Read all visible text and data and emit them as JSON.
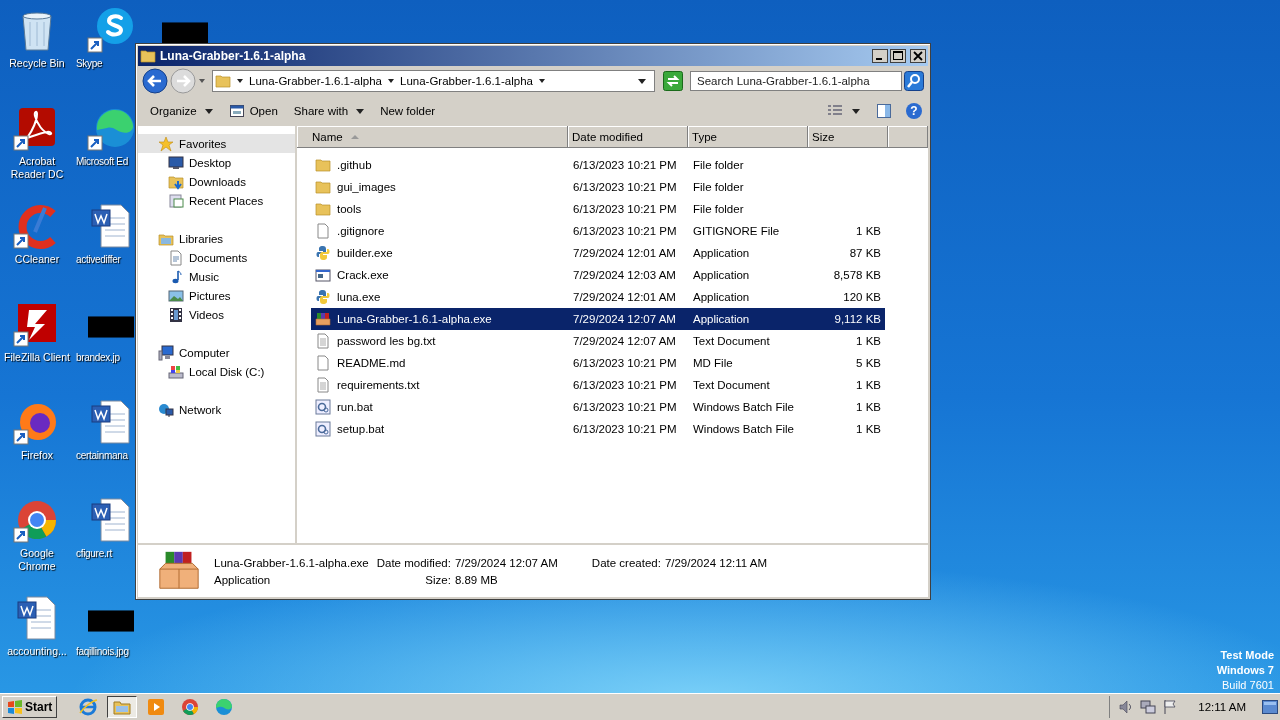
{
  "desktop": {
    "icon_columns": [
      {
        "icons": [
          {
            "label": "Recycle Bin",
            "kind": "recycle",
            "shortcut": false
          },
          {
            "label": "Acrobat Reader DC",
            "kind": "acrobat",
            "shortcut": true
          },
          {
            "label": "CCleaner",
            "kind": "ccleaner",
            "shortcut": true
          },
          {
            "label": "FileZilla Client",
            "kind": "filezilla",
            "shortcut": true
          },
          {
            "label": "Firefox",
            "kind": "firefox",
            "shortcut": true
          },
          {
            "label": "Google Chrome",
            "kind": "chrome",
            "shortcut": true
          },
          {
            "label": "accounting...",
            "kind": "word",
            "shortcut": false
          }
        ]
      },
      {
        "icons": [
          {
            "label": "Skype",
            "kind": "skype",
            "shortcut": true
          },
          {
            "label": "Microsoft Ed",
            "kind": "edge",
            "shortcut": true
          },
          {
            "label": "activediffer",
            "kind": "word",
            "shortcut": false
          },
          {
            "label": "brandex.jp",
            "kind": "redacted",
            "shortcut": false
          },
          {
            "label": "certainmana",
            "kind": "word",
            "shortcut": false
          },
          {
            "label": "cfigure.rt",
            "kind": "word",
            "shortcut": false
          },
          {
            "label": "faqillinois.jpg",
            "kind": "redacted",
            "shortcut": false
          }
        ]
      },
      {
        "icons": [
          {
            "kind": "redacted",
            "shortcut": false
          }
        ]
      }
    ]
  },
  "window": {
    "title": "Luna-Grabber-1.6.1-alpha",
    "breadcrumb": [
      "Luna-Grabber-1.6.1-alpha",
      "Luna-Grabber-1.6.1-alpha"
    ],
    "search": {
      "placeholder": "Search Luna-Grabber-1.6.1-alpha"
    },
    "toolbar": [
      {
        "label": "Organize",
        "kind": "plain",
        "dropdown": true
      },
      {
        "label": "Open",
        "kind": "open",
        "dropdown": false
      },
      {
        "label": "Share with",
        "kind": "plain",
        "dropdown": true
      },
      {
        "label": "New folder",
        "kind": "plain",
        "dropdown": false
      }
    ],
    "help": "?",
    "nav_pane": [
      {
        "label": "Favorites",
        "kind": "star",
        "selected": true,
        "children": [
          {
            "label": "Desktop",
            "kind": "desktop",
            "selected": false
          },
          {
            "label": "Downloads",
            "kind": "downloads",
            "selected": false
          },
          {
            "label": "Recent Places",
            "kind": "recent",
            "selected": false
          }
        ]
      },
      {
        "label": "Libraries",
        "kind": "libraries",
        "selected": false,
        "children": [
          {
            "label": "Documents",
            "kind": "document",
            "selected": false
          },
          {
            "label": "Music",
            "kind": "music",
            "selected": false
          },
          {
            "label": "Pictures",
            "kind": "pictures",
            "selected": false
          },
          {
            "label": "Videos",
            "kind": "videos",
            "selected": false
          }
        ]
      },
      {
        "label": "Computer",
        "kind": "computer",
        "selected": false,
        "children": [
          {
            "label": "Local Disk (C:)",
            "kind": "disk",
            "selected": false
          }
        ]
      },
      {
        "label": "Network",
        "kind": "network",
        "selected": false
      }
    ],
    "columns": [
      {
        "label": "Name",
        "sorted": true
      },
      {
        "label": "Date modified",
        "sorted": false
      },
      {
        "label": "Type",
        "sorted": false
      },
      {
        "label": "Size",
        "sorted": false
      }
    ],
    "rows": [
      {
        "name": ".github",
        "date": "6/13/2023 10:21 PM",
        "type": "File folder",
        "kind": "folder",
        "selected": false
      },
      {
        "name": "gui_images",
        "date": "6/13/2023 10:21 PM",
        "type": "File folder",
        "kind": "folder",
        "selected": false
      },
      {
        "name": "tools",
        "date": "6/13/2023 10:21 PM",
        "type": "File folder",
        "kind": "folder",
        "selected": false
      },
      {
        "name": ".gitignore",
        "date": "6/13/2023 10:21 PM",
        "type": "GITIGNORE File",
        "size": "1 KB",
        "kind": "blank",
        "selected": false
      },
      {
        "name": "builder.exe",
        "date": "7/29/2024 12:01 AM",
        "type": "Application",
        "size": "87 KB",
        "kind": "python",
        "selected": false
      },
      {
        "name": "Crack.exe",
        "date": "7/29/2024 12:03 AM",
        "type": "Application",
        "size": "8,578 KB",
        "kind": "window",
        "selected": false
      },
      {
        "name": "luna.exe",
        "date": "7/29/2024 12:01 AM",
        "type": "Application",
        "size": "120 KB",
        "kind": "python",
        "selected": false
      },
      {
        "name": "Luna-Grabber-1.6.1-alpha.exe",
        "date": "7/29/2024 12:07 AM",
        "type": "Application",
        "size": "9,112 KB",
        "kind": "archive",
        "selected": true
      },
      {
        "name": "password les bg.txt",
        "date": "7/29/2024 12:07 AM",
        "type": "Text Document",
        "size": "1 KB",
        "kind": "text",
        "selected": false
      },
      {
        "name": "README.md",
        "date": "6/13/2023 10:21 PM",
        "type": "MD File",
        "size": "5 KB",
        "kind": "blank",
        "selected": false
      },
      {
        "name": "requirements.txt",
        "date": "6/13/2023 10:21 PM",
        "type": "Text Document",
        "size": "1 KB",
        "kind": "text",
        "selected": false
      },
      {
        "name": "run.bat",
        "date": "6/13/2023 10:21 PM",
        "type": "Windows Batch File",
        "size": "1 KB",
        "kind": "batch",
        "selected": false
      },
      {
        "name": "setup.bat",
        "date": "6/13/2023 10:21 PM",
        "type": "Windows Batch File",
        "size": "1 KB",
        "kind": "batch",
        "selected": false
      }
    ],
    "details": {
      "name": "Luna-Grabber-1.6.1-alpha.exe",
      "type": "Application",
      "modified_label": "Date modified:",
      "modified": "7/29/2024 12:07 AM",
      "created_label": "Date created:",
      "created": "7/29/2024 12:11 AM",
      "size_label": "Size:",
      "size": "8.89 MB"
    }
  },
  "taskbar": {
    "start": "Start",
    "apps": [
      {
        "kind": "ie",
        "active": false
      },
      {
        "kind": "explorer",
        "active": true
      },
      {
        "kind": "media",
        "active": false
      },
      {
        "kind": "chrome",
        "active": false
      },
      {
        "kind": "edge",
        "active": false
      }
    ],
    "clock": "12:11 AM"
  },
  "test_mode": [
    "Test Mode",
    "Windows 7",
    "Build 7601"
  ]
}
